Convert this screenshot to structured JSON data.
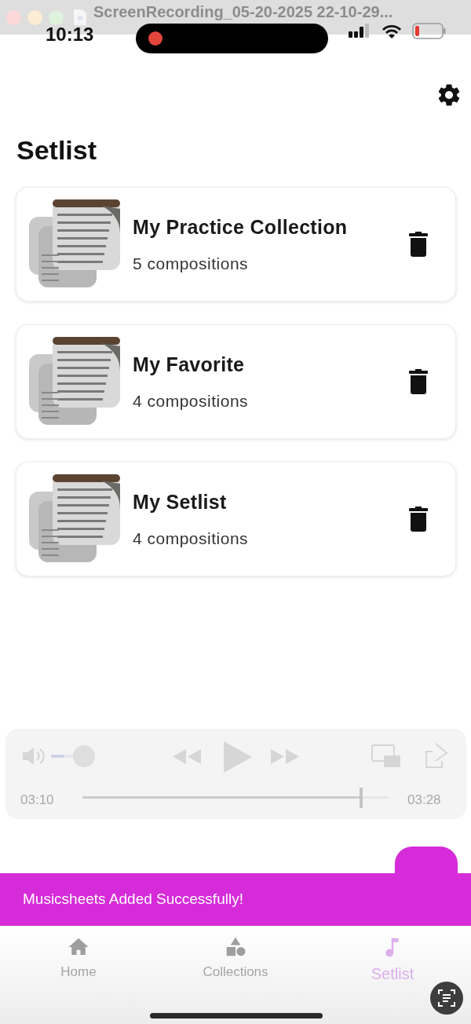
{
  "window": {
    "title": "ScreenRecording_05-20-2025 22-10-29..."
  },
  "status_bar": {
    "time": "10:13",
    "recording": true
  },
  "page_title": "Setlist",
  "setlists": [
    {
      "name": "My Practice Collection",
      "count": "5 compositions"
    },
    {
      "name": "My Favorite",
      "count": "4 compositions"
    },
    {
      "name": "My Setlist",
      "count": "4 compositions"
    }
  ],
  "player": {
    "volume": {
      "level": 0.3
    },
    "elapsed": "03:10",
    "progress": {
      "level": 0.91
    },
    "total": "03:28"
  },
  "snackbar": "Musicsheets Added Successfully!",
  "nav": [
    {
      "label": "Home",
      "selected": false
    },
    {
      "label": "Collections",
      "selected": false
    },
    {
      "label": "Setlist",
      "selected": true
    }
  ]
}
